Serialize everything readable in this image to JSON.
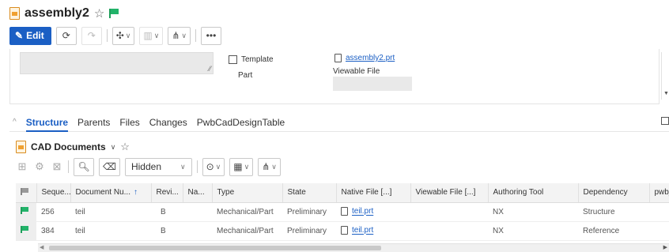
{
  "header": {
    "title": "assembly2",
    "star_icon": "star-outline-icon",
    "flag_icon": "green-flag-icon"
  },
  "toolbar": {
    "edit_label": "Edit",
    "more_label": "•••"
  },
  "form": {
    "template_label": "Template",
    "part_label": "Part",
    "native_file_link": "assembly2.prt",
    "viewable_file_label": "Viewable File"
  },
  "tabs": [
    "Structure",
    "Parents",
    "Files",
    "Changes",
    "PwbCadDesignTable"
  ],
  "section": {
    "title": "CAD Documents",
    "filter_select": "Hidden"
  },
  "table": {
    "columns": [
      "Seque...",
      "Document Nu...",
      "Revi...",
      "Na...",
      "Type",
      "State",
      "Native File [...]",
      "Viewable File [...]",
      "Authoring Tool",
      "Dependency",
      "pwb_c"
    ],
    "rows": [
      [
        "256",
        "teil",
        "B",
        "",
        "Mechanical/Part",
        "Preliminary",
        "teil.prt",
        "",
        "NX",
        "Structure",
        ""
      ],
      [
        "384",
        "teil",
        "B",
        "",
        "Mechanical/Part",
        "Preliminary",
        "teil.prt",
        "",
        "NX",
        "Reference",
        ""
      ]
    ]
  },
  "colors": {
    "accent": "#1b5fc4",
    "flag_green": "#22b36a",
    "doc_orange": "#f0a030"
  }
}
